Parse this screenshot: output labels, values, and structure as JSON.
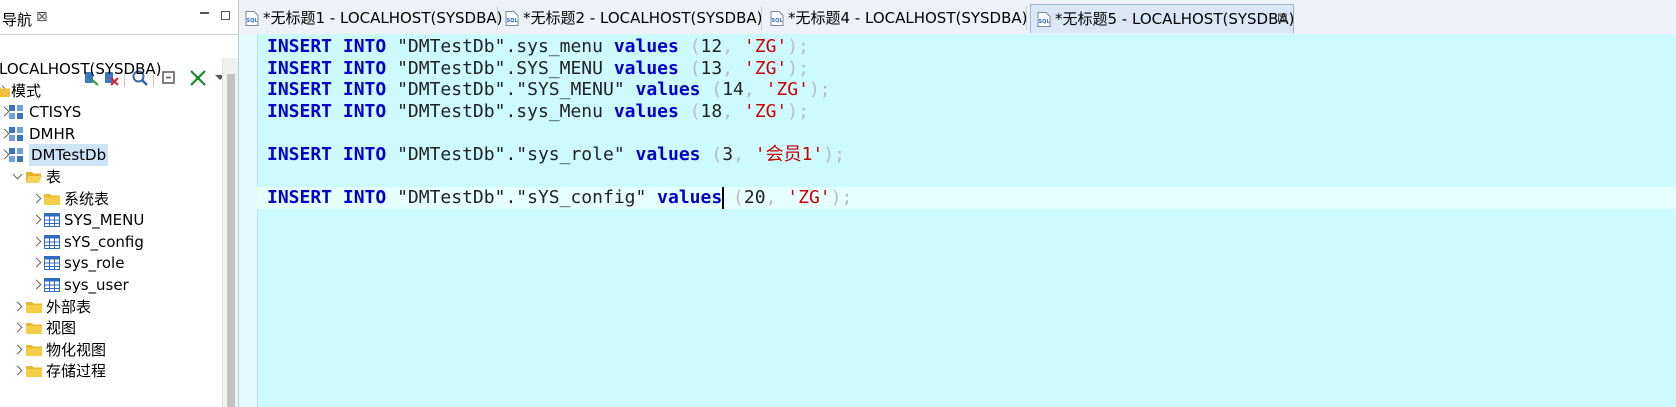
{
  "navigator": {
    "title": "导航",
    "close_glyph": "⊠",
    "tree": [
      {
        "label": "LOCALHOST(SYSDBA)",
        "icon": "server-icon",
        "level": 0
      },
      {
        "label": "模式",
        "icon": "schema-folder-icon",
        "level": 0
      },
      {
        "label": "CTISYS",
        "icon": "schema-icon",
        "level": 1
      },
      {
        "label": "DMHR",
        "icon": "schema-icon",
        "level": 1
      },
      {
        "label": "DMTestDb",
        "icon": "schema-icon",
        "level": 1,
        "selected": true
      },
      {
        "label": "表",
        "icon": "folder-open-icon",
        "level": 2,
        "expanded": true
      },
      {
        "label": "系统表",
        "icon": "folder-icon",
        "level": 3
      },
      {
        "label": "SYS_MENU",
        "icon": "table-icon",
        "level": 3
      },
      {
        "label": "sYS_config",
        "icon": "table-icon",
        "level": 3
      },
      {
        "label": "sys_role",
        "icon": "table-icon",
        "level": 3
      },
      {
        "label": "sys_user",
        "icon": "table-icon",
        "level": 3
      },
      {
        "label": "外部表",
        "icon": "folder-icon",
        "level": 2
      },
      {
        "label": "视图",
        "icon": "folder-icon",
        "level": 2
      },
      {
        "label": "物化视图",
        "icon": "folder-icon",
        "level": 2
      },
      {
        "label": "存储过程",
        "icon": "folder-icon",
        "level": 2
      }
    ]
  },
  "editor": {
    "tabs": [
      {
        "label": "*无标题1 - LOCALHOST(SYSDBA)",
        "active": false
      },
      {
        "label": "*无标题2 - LOCALHOST(SYSDBA)",
        "active": false
      },
      {
        "label": "*无标题4 - LOCALHOST(SYSDBA)",
        "active": false
      },
      {
        "label": "*无标题5 - LOCALHOST(SYSDBA)",
        "active": true
      }
    ],
    "tab_close_glyph": "⊠",
    "lines": [
      [
        [
          "kw",
          "INSERT"
        ],
        [
          "sp",
          " "
        ],
        [
          "kw",
          "INTO"
        ],
        [
          "sp",
          " "
        ],
        [
          "idf",
          "\"DMTestDb\".sys_menu"
        ],
        [
          "sp",
          " "
        ],
        [
          "kw",
          "values"
        ],
        [
          "sp",
          " "
        ],
        [
          "punc",
          "("
        ],
        [
          "num",
          "12"
        ],
        [
          "punc",
          ","
        ],
        [
          "sp",
          " "
        ],
        [
          "str",
          "'ZG'"
        ],
        [
          "punc",
          ");"
        ]
      ],
      [
        [
          "kw",
          "INSERT"
        ],
        [
          "sp",
          " "
        ],
        [
          "kw",
          "INTO"
        ],
        [
          "sp",
          " "
        ],
        [
          "idf",
          "\"DMTestDb\".SYS_MENU"
        ],
        [
          "sp",
          " "
        ],
        [
          "kw",
          "values"
        ],
        [
          "sp",
          " "
        ],
        [
          "punc",
          "("
        ],
        [
          "num",
          "13"
        ],
        [
          "punc",
          ","
        ],
        [
          "sp",
          " "
        ],
        [
          "str",
          "'ZG'"
        ],
        [
          "punc",
          ");"
        ]
      ],
      [
        [
          "kw",
          "INSERT"
        ],
        [
          "sp",
          " "
        ],
        [
          "kw",
          "INTO"
        ],
        [
          "sp",
          " "
        ],
        [
          "idf",
          "\"DMTestDb\".\"SYS_MENU\""
        ],
        [
          "sp",
          " "
        ],
        [
          "kw",
          "values"
        ],
        [
          "sp",
          " "
        ],
        [
          "punc",
          "("
        ],
        [
          "num",
          "14"
        ],
        [
          "punc",
          ","
        ],
        [
          "sp",
          " "
        ],
        [
          "str",
          "'ZG'"
        ],
        [
          "punc",
          ");"
        ]
      ],
      [
        [
          "kw",
          "INSERT"
        ],
        [
          "sp",
          " "
        ],
        [
          "kw",
          "INTO"
        ],
        [
          "sp",
          " "
        ],
        [
          "idf",
          "\"DMTestDb\".sys_Menu"
        ],
        [
          "sp",
          " "
        ],
        [
          "kw",
          "values"
        ],
        [
          "sp",
          " "
        ],
        [
          "punc",
          "("
        ],
        [
          "num",
          "18"
        ],
        [
          "punc",
          ","
        ],
        [
          "sp",
          " "
        ],
        [
          "str",
          "'ZG'"
        ],
        [
          "punc",
          ");"
        ]
      ],
      [],
      [
        [
          "kw",
          "INSERT"
        ],
        [
          "sp",
          " "
        ],
        [
          "kw",
          "INTO"
        ],
        [
          "sp",
          " "
        ],
        [
          "idf",
          "\"DMTestDb\".\"sys_role\""
        ],
        [
          "sp",
          " "
        ],
        [
          "kw",
          "values"
        ],
        [
          "sp",
          " "
        ],
        [
          "punc",
          "("
        ],
        [
          "num",
          "3"
        ],
        [
          "punc",
          ","
        ],
        [
          "sp",
          " "
        ],
        [
          "str",
          "'会员1'"
        ],
        [
          "punc",
          ");"
        ]
      ],
      [],
      [
        [
          "kw",
          "INSERT"
        ],
        [
          "sp",
          " "
        ],
        [
          "kw",
          "INTO"
        ],
        [
          "sp",
          " "
        ],
        [
          "idf",
          "\"DMTestDb\".\"sYS_config\""
        ],
        [
          "sp",
          " "
        ],
        [
          "kw",
          "values"
        ],
        [
          "sp",
          " "
        ],
        [
          "punc",
          "("
        ],
        [
          "num",
          "20"
        ],
        [
          "punc",
          ","
        ],
        [
          "sp",
          " "
        ],
        [
          "str",
          "'ZG'"
        ],
        [
          "punc",
          ");"
        ]
      ]
    ]
  }
}
